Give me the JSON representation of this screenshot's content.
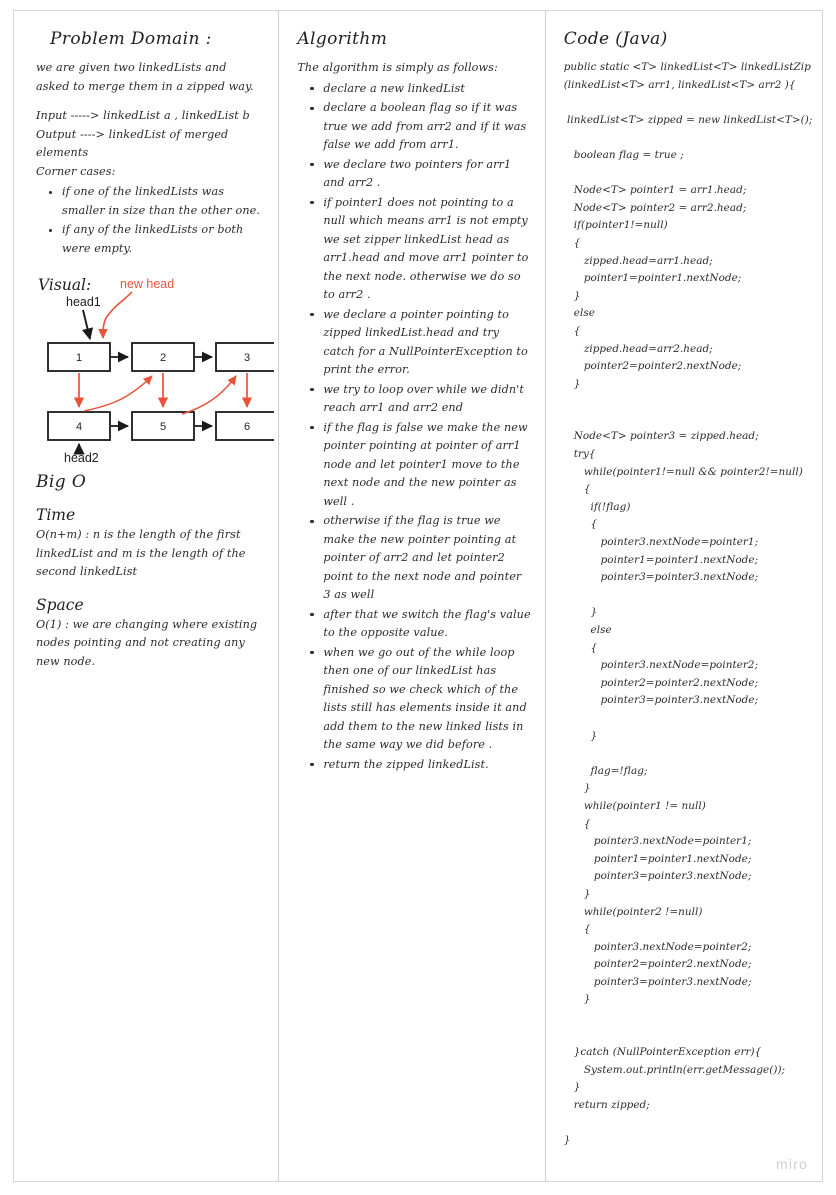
{
  "colors": {
    "ink": "#2b2b2b",
    "accent_red": "#e8533c",
    "border": "#d5d5d5",
    "watermark": "#cfcfcf"
  },
  "watermark": "miro",
  "columns": {
    "problem": {
      "title": "Problem Domain :",
      "intro": "we are given two linkedLists and asked to merge them in a zipped way.",
      "input_line": "Input -----> linkedList a , linkedList b",
      "output_line": "Output ----> linkedList of merged elements",
      "corner_cases_label": "Corner cases:",
      "corner_cases": [
        "if one of the linkedLists was smaller in size than the other one.",
        "if any of the linkedLists or both were empty."
      ],
      "visual": {
        "label": "Visual:",
        "new_head_label": "new head",
        "head1_label": "head1",
        "head2_label": "head2",
        "top_nodes": [
          "1",
          "2",
          "3"
        ],
        "bottom_nodes": [
          "4",
          "5",
          "6"
        ]
      },
      "bigo": {
        "title": "Big O",
        "time_label": "Time",
        "time_text": "O(n+m) : n is the length of the first linkedList  and m is the length of the second linkedList",
        "space_label": "Space",
        "space_text": "O(1) : we are changing where existing nodes pointing and not creating any new node."
      }
    },
    "algorithm": {
      "title": "Algorithm",
      "intro": "The algorithm is simply as follows:",
      "steps": [
        "declare a new linkedList",
        "declare a boolean flag so if it was true we add from arr2 and if it was false we add from arr1.",
        "we declare two pointers for arr1 and arr2 .",
        "if pointer1 does not pointing to a null which means arr1 is not empty we set zipper linkedList head as arr1.head and move arr1 pointer to the next node. otherwise we do so to arr2 .",
        "we declare a pointer pointing to zipped linkedList.head and try catch for a NullPointerException to print the error.",
        "we try to loop over while we didn't reach arr1 and arr2 end",
        "if the flag is false we make the new pointer pointing at pointer of arr1 node and let pointer1 move to the next node and the new pointer as well .",
        "otherwise if the flag is true we make the new pointer pointing at pointer of arr2 and let pointer2 point to the next node and pointer 3 as well",
        "after that we switch the flag's value to the opposite value.",
        "when we go out of the while loop then one of our linkedList has finished so we check which of the lists still has elements inside it and add them to the new linked lists in the same way we did before .",
        "return the zipped linkedList."
      ]
    },
    "code": {
      "title": "Code (Java)",
      "language": "Java",
      "source": "public static <T> linkedList<T> linkedListZip\n(linkedList<T> arr1, linkedList<T> arr2 ){\n\n linkedList<T> zipped = new linkedList<T>();\n\n   boolean flag = true ;\n\n   Node<T> pointer1 = arr1.head;\n   Node<T> pointer2 = arr2.head;\n   if(pointer1!=null)\n   {\n      zipped.head=arr1.head;\n      pointer1=pointer1.nextNode;\n   }\n   else\n   {\n      zipped.head=arr2.head;\n      pointer2=pointer2.nextNode;\n   }\n\n\n   Node<T> pointer3 = zipped.head;\n   try{\n      while(pointer1!=null && pointer2!=null)\n      {\n        if(!flag)\n        {\n           pointer3.nextNode=pointer1;\n           pointer1=pointer1.nextNode;\n           pointer3=pointer3.nextNode;\n\n        }\n        else\n        {\n           pointer3.nextNode=pointer2;\n           pointer2=pointer2.nextNode;\n           pointer3=pointer3.nextNode;\n\n        }\n\n        flag=!flag;\n      }\n      while(pointer1 != null)\n      {\n         pointer3.nextNode=pointer1;\n         pointer1=pointer1.nextNode;\n         pointer3=pointer3.nextNode;\n      }\n      while(pointer2 !=null)\n      {\n         pointer3.nextNode=pointer2;\n         pointer2=pointer2.nextNode;\n         pointer3=pointer3.nextNode;\n      }\n\n\n   }catch (NullPointerException err){\n      System.out.println(err.getMessage());\n   }\n   return zipped;\n\n}"
    }
  }
}
